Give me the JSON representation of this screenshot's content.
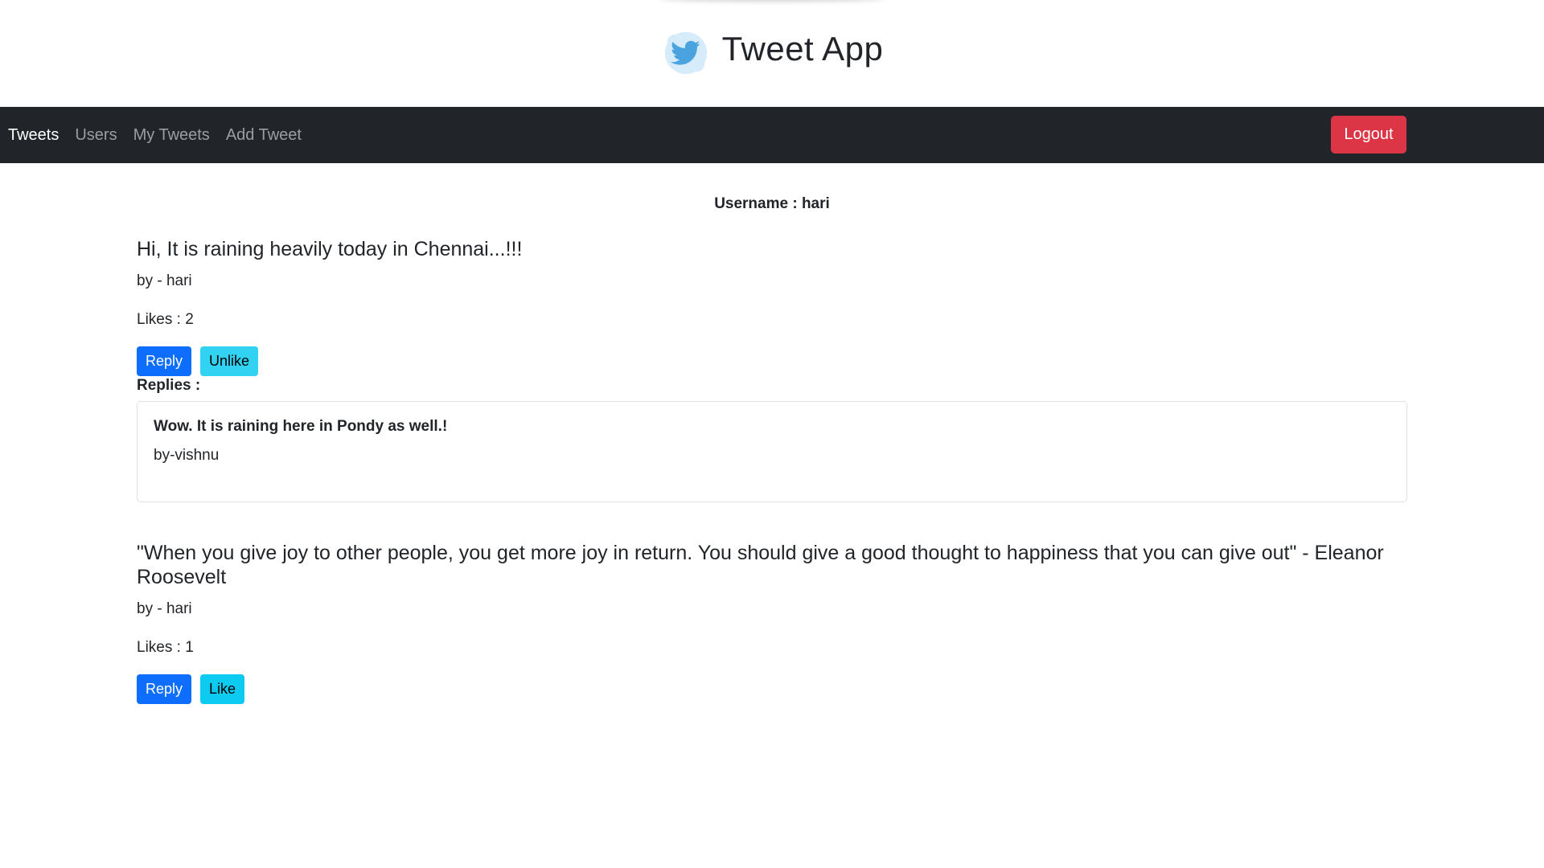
{
  "app": {
    "title": "Tweet App",
    "logo_icon": "twitter-bird-icon"
  },
  "nav": {
    "items": [
      {
        "label": "Tweets",
        "active": true
      },
      {
        "label": "Users",
        "active": false
      },
      {
        "label": "My Tweets",
        "active": false
      },
      {
        "label": "Add Tweet",
        "active": false
      }
    ],
    "logout_label": "Logout"
  },
  "user": {
    "username_line": "Username : hari"
  },
  "tweets": [
    {
      "text": "Hi, It is raining heavily today in Chennai...!!!",
      "author_line": "by - hari",
      "likes_line": "Likes : 2",
      "reply_label": "Reply",
      "like_label": "Unlike",
      "replies_label": "Replies :",
      "replies": [
        {
          "text": "Wow. It is raining here in Pondy as well.!",
          "author_line": "by-vishnu"
        }
      ]
    },
    {
      "text": "\"When you give joy to other people, you get more joy in return. You should give a good thought to happiness that you can give out\" - Eleanor Roosevelt",
      "author_line": "by - hari",
      "likes_line": "Likes : 1",
      "reply_label": "Reply",
      "like_label": "Like"
    }
  ],
  "colors": {
    "navbar": "#212529",
    "logout": "#dc3545",
    "primary": "#0d6efd",
    "info": "#0dcaf0"
  }
}
